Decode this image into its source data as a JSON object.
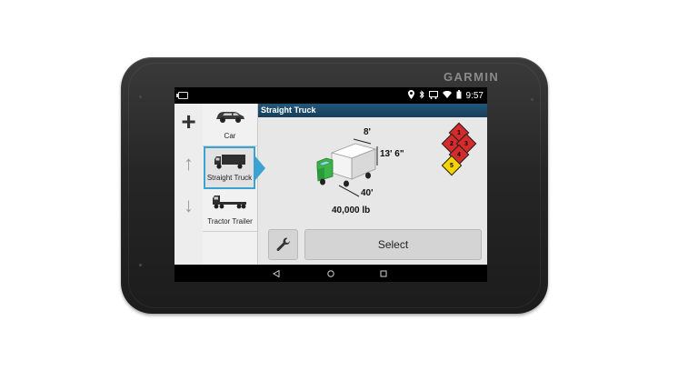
{
  "device": {
    "brand": "GARMIN"
  },
  "status_bar": {
    "time": "9:57"
  },
  "side_controls": {
    "plus": "+",
    "up": "↑",
    "down": "↓"
  },
  "vehicles": [
    {
      "label": "Car",
      "icon": "car-icon"
    },
    {
      "label": "Straight Truck",
      "icon": "straight-truck-icon",
      "selected": true
    },
    {
      "label": "Tractor Trailer",
      "icon": "tractor-trailer-icon"
    }
  ],
  "panel": {
    "title": "Straight Truck",
    "width": "8'",
    "height": "13' 6\"",
    "length": "40'",
    "weight": "40,000  lb",
    "hazmat_labels": [
      "1",
      "2",
      "3",
      "4",
      "5"
    ],
    "select_label": "Select"
  },
  "colors": {
    "accent": "#3aa3d3",
    "title_bar": "#1d4d6e",
    "truck_cab": "#3cb44a",
    "hazmat_red": "#d42b2b",
    "hazmat_yellow": "#f3d400"
  }
}
